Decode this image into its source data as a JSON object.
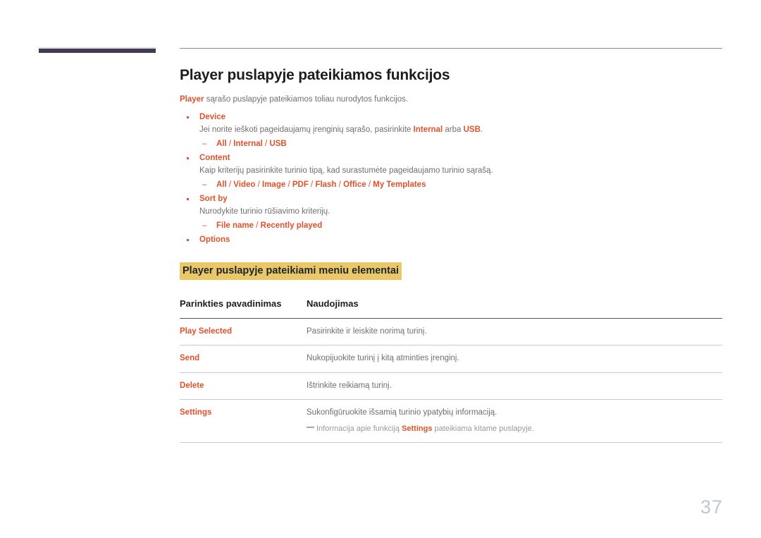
{
  "page": {
    "number": "37"
  },
  "header": {
    "title": "Player puslapyje pateikiamos funkcijos",
    "intro_lead": "Player",
    "intro_rest": " sąrašo puslapyje pateikiamos toliau nurodytos funkcijos."
  },
  "features": [
    {
      "label": "Device",
      "description_pre": "Jei norite ieškoti pageidaujamų įrenginių sąrašo, pasirinkite ",
      "description_b1": "Internal",
      "description_mid": " arba ",
      "description_b2": "USB",
      "description_post": ".",
      "options": [
        "All",
        "Internal",
        "USB"
      ]
    },
    {
      "label": "Content",
      "description": "Kaip kriterijų pasirinkite turinio tipą, kad surastumėte pageidaujamo turinio sąrašą.",
      "options": [
        "All",
        "Video",
        "Image",
        "PDF",
        "Flash",
        "Office",
        "My Templates"
      ]
    },
    {
      "label": "Sort by",
      "description": "Nurodykite turinio rūšiavimo kriterijų.",
      "options": [
        "File name",
        "Recently played"
      ]
    },
    {
      "label": "Options",
      "description": "",
      "options": []
    }
  ],
  "section": {
    "highlight_heading": "Player puslapyje pateikiami meniu elementai"
  },
  "table": {
    "columns": [
      "Parinkties pavadinimas",
      "Naudojimas"
    ],
    "rows": [
      {
        "name": "Play Selected",
        "use": "Pasirinkite ir leiskite norimą turinį."
      },
      {
        "name": "Send",
        "use": "Nukopijuokite turinį į kitą atminties įrenginį."
      },
      {
        "name": "Delete",
        "use": "Ištrinkite reikiamą turinį."
      },
      {
        "name": "Settings",
        "use": "Sukonfigūruokite išsamią turinio ypatybių informaciją.",
        "note_pre": "Informacija apie funkciją ",
        "note_bold": "Settings",
        "note_post": " pateikiama kitame puslapyje."
      }
    ]
  },
  "colors": {
    "accent_orange": "#e0512a",
    "highlight_yellow": "#ebc867",
    "deco_plum": "#443a50",
    "body_gray": "#6f6f6f",
    "page_number_gray": "#c2c6d0"
  }
}
